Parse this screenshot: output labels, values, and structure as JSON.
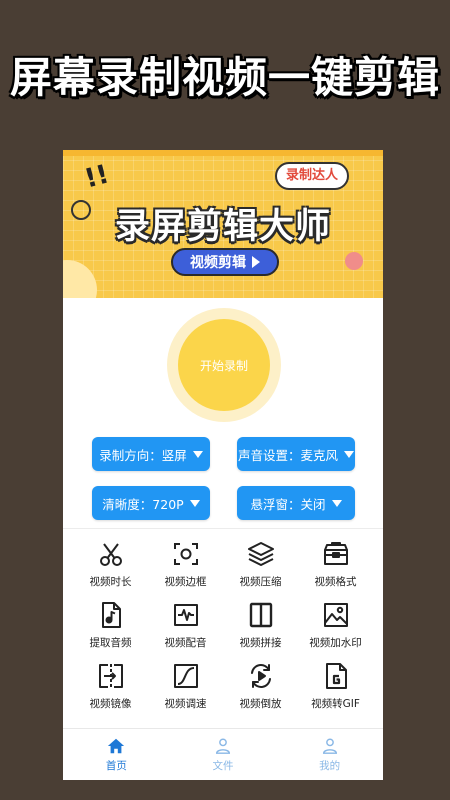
{
  "promo": {
    "title": "屏幕录制视频一键剪辑"
  },
  "banner": {
    "tag": "录制达人",
    "title": "录屏剪辑大师",
    "button": "视频剪辑",
    "exclaim": "!!"
  },
  "record": {
    "label": "开始录制"
  },
  "settings": [
    {
      "label": "录制方向：竖屏"
    },
    {
      "label": "声音设置：麦克风"
    },
    {
      "label": "清晰度：720P"
    },
    {
      "label": "悬浮窗：关闭"
    }
  ],
  "tools": [
    {
      "label": "视频时长",
      "icon": "scissors-icon"
    },
    {
      "label": "视频边框",
      "icon": "frame-camera-icon"
    },
    {
      "label": "视频压缩",
      "icon": "layers-icon"
    },
    {
      "label": "视频格式",
      "icon": "toolbox-icon"
    },
    {
      "label": "提取音频",
      "icon": "music-file-icon"
    },
    {
      "label": "视频配音",
      "icon": "waveform-icon"
    },
    {
      "label": "视频拼接",
      "icon": "split-panel-icon"
    },
    {
      "label": "视频加水印",
      "icon": "image-icon"
    },
    {
      "label": "视频镜像",
      "icon": "mirror-icon"
    },
    {
      "label": "视频调速",
      "icon": "speed-curve-icon"
    },
    {
      "label": "视频倒放",
      "icon": "reverse-icon"
    },
    {
      "label": "视频转GIF",
      "icon": "gif-icon"
    }
  ],
  "nav": [
    {
      "label": "首页",
      "icon": "home-icon",
      "active": true
    },
    {
      "label": "文件",
      "icon": "user-icon",
      "active": false
    },
    {
      "label": "我的",
      "icon": "profile-icon",
      "active": false
    }
  ],
  "colors": {
    "background": "#4a3e34",
    "banner": "#f8c94a",
    "accent_blue": "#2196f3",
    "record_yellow": "#fbd54a",
    "nav_active": "#1e78d6"
  }
}
